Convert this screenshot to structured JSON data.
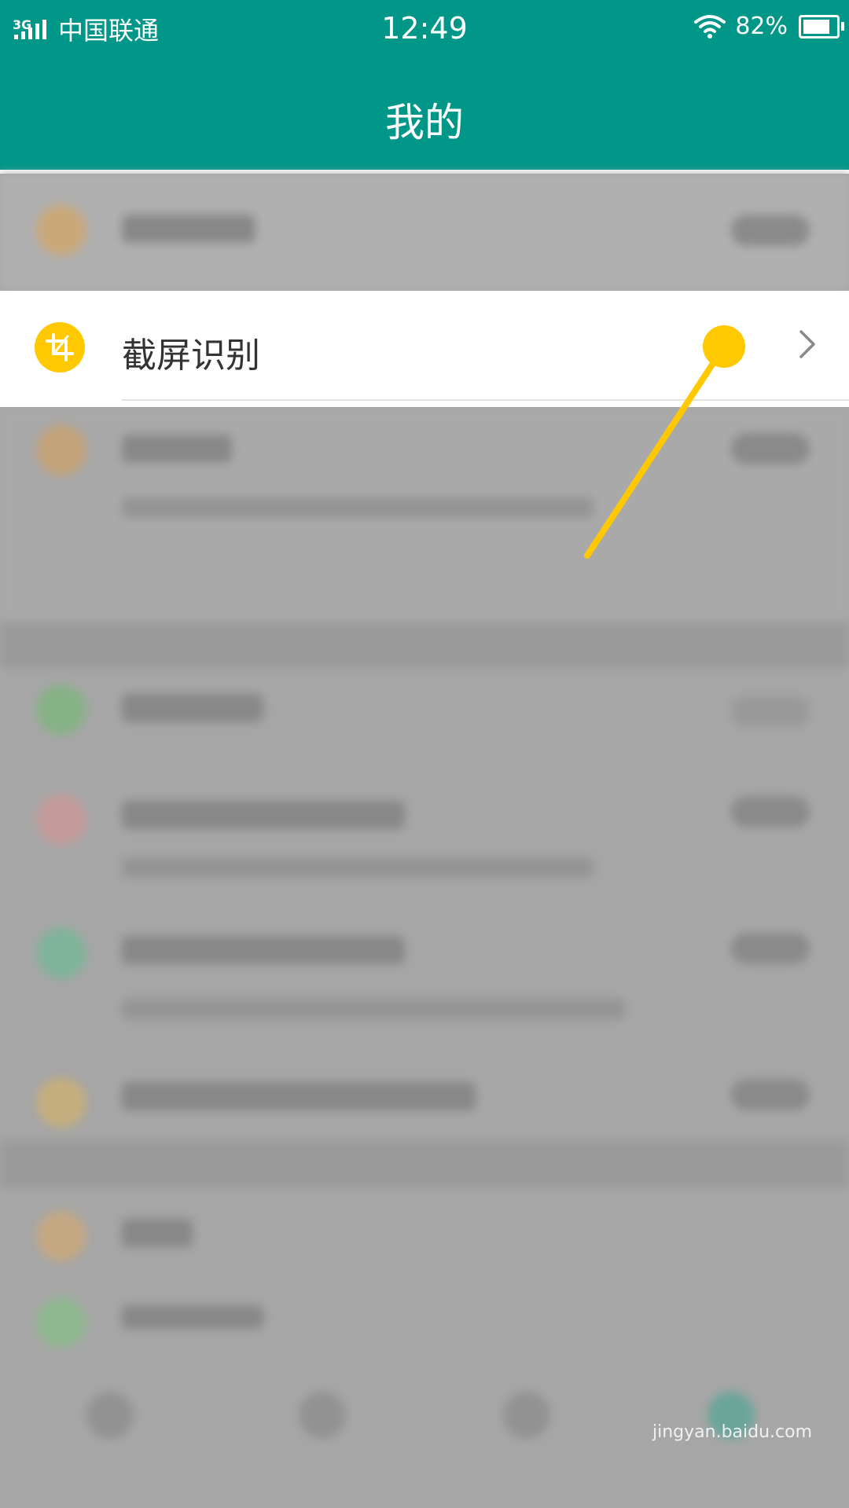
{
  "status_bar": {
    "network": "3G",
    "carrier": "中国联通",
    "time": "12:49",
    "battery": "82%",
    "battery_level": 0.82
  },
  "nav": {
    "title": "我的"
  },
  "highlighted_item": {
    "label": "截屏识别",
    "icon": "crop-icon"
  },
  "colors": {
    "header": "#009688",
    "accent": "#ffc800",
    "overlay": "#a7a7a7"
  },
  "watermark": {
    "site": "jingyan.baidu.com"
  }
}
